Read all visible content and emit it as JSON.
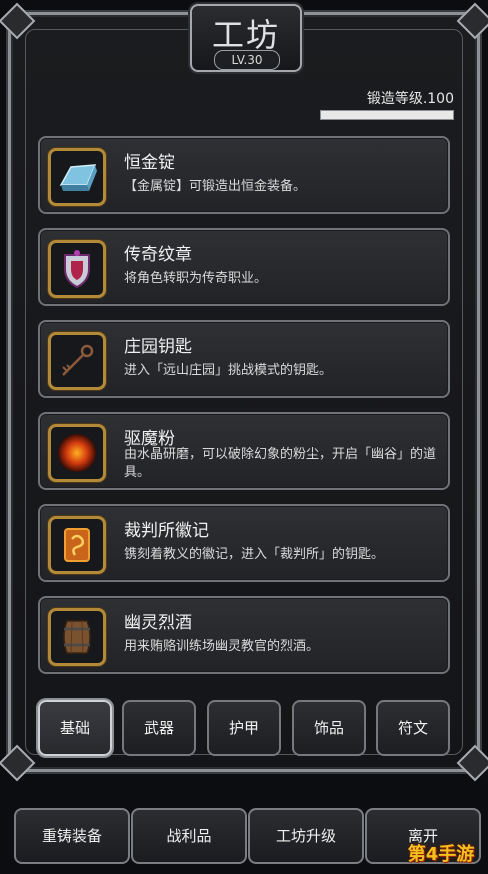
{
  "header": {
    "title": "工坊",
    "level": "LV.30",
    "forge_level_label": "锻造等级.100",
    "forge_progress": 1.0
  },
  "items": [
    {
      "name": "恒金锭",
      "desc": "【金属锭】可锻造出恒金装备。",
      "icon": "ingot-icon"
    },
    {
      "name": "传奇纹章",
      "desc": "将角色转职为传奇职业。",
      "icon": "crest-icon"
    },
    {
      "name": "庄园钥匙",
      "desc": "进入「远山庄园」挑战模式的钥匙。",
      "icon": "key-icon"
    },
    {
      "name": "驱魔粉",
      "desc": "由水晶研磨，可以破除幻象的粉尘，开启「幽谷」的道具。",
      "icon": "powder-icon"
    },
    {
      "name": "裁判所徽记",
      "desc": "镌刻着教义的徽记，进入「裁判所」的钥匙。",
      "icon": "emblem-icon"
    },
    {
      "name": "幽灵烈酒",
      "desc": "用来贿赂训练场幽灵教官的烈酒。",
      "icon": "barrel-icon"
    }
  ],
  "tabs": [
    {
      "label": "基础",
      "active": true
    },
    {
      "label": "武器",
      "active": false
    },
    {
      "label": "护甲",
      "active": false
    },
    {
      "label": "饰品",
      "active": false
    },
    {
      "label": "符文",
      "active": false
    }
  ],
  "bottom_buttons": [
    {
      "label": "重铸装备"
    },
    {
      "label": "战利品"
    },
    {
      "label": "工坊升级"
    },
    {
      "label": "离开"
    }
  ],
  "watermark": "第4手游",
  "colors": {
    "icon_frame": "#b38a3a",
    "panel": "#222327",
    "border": "#6f7277"
  }
}
